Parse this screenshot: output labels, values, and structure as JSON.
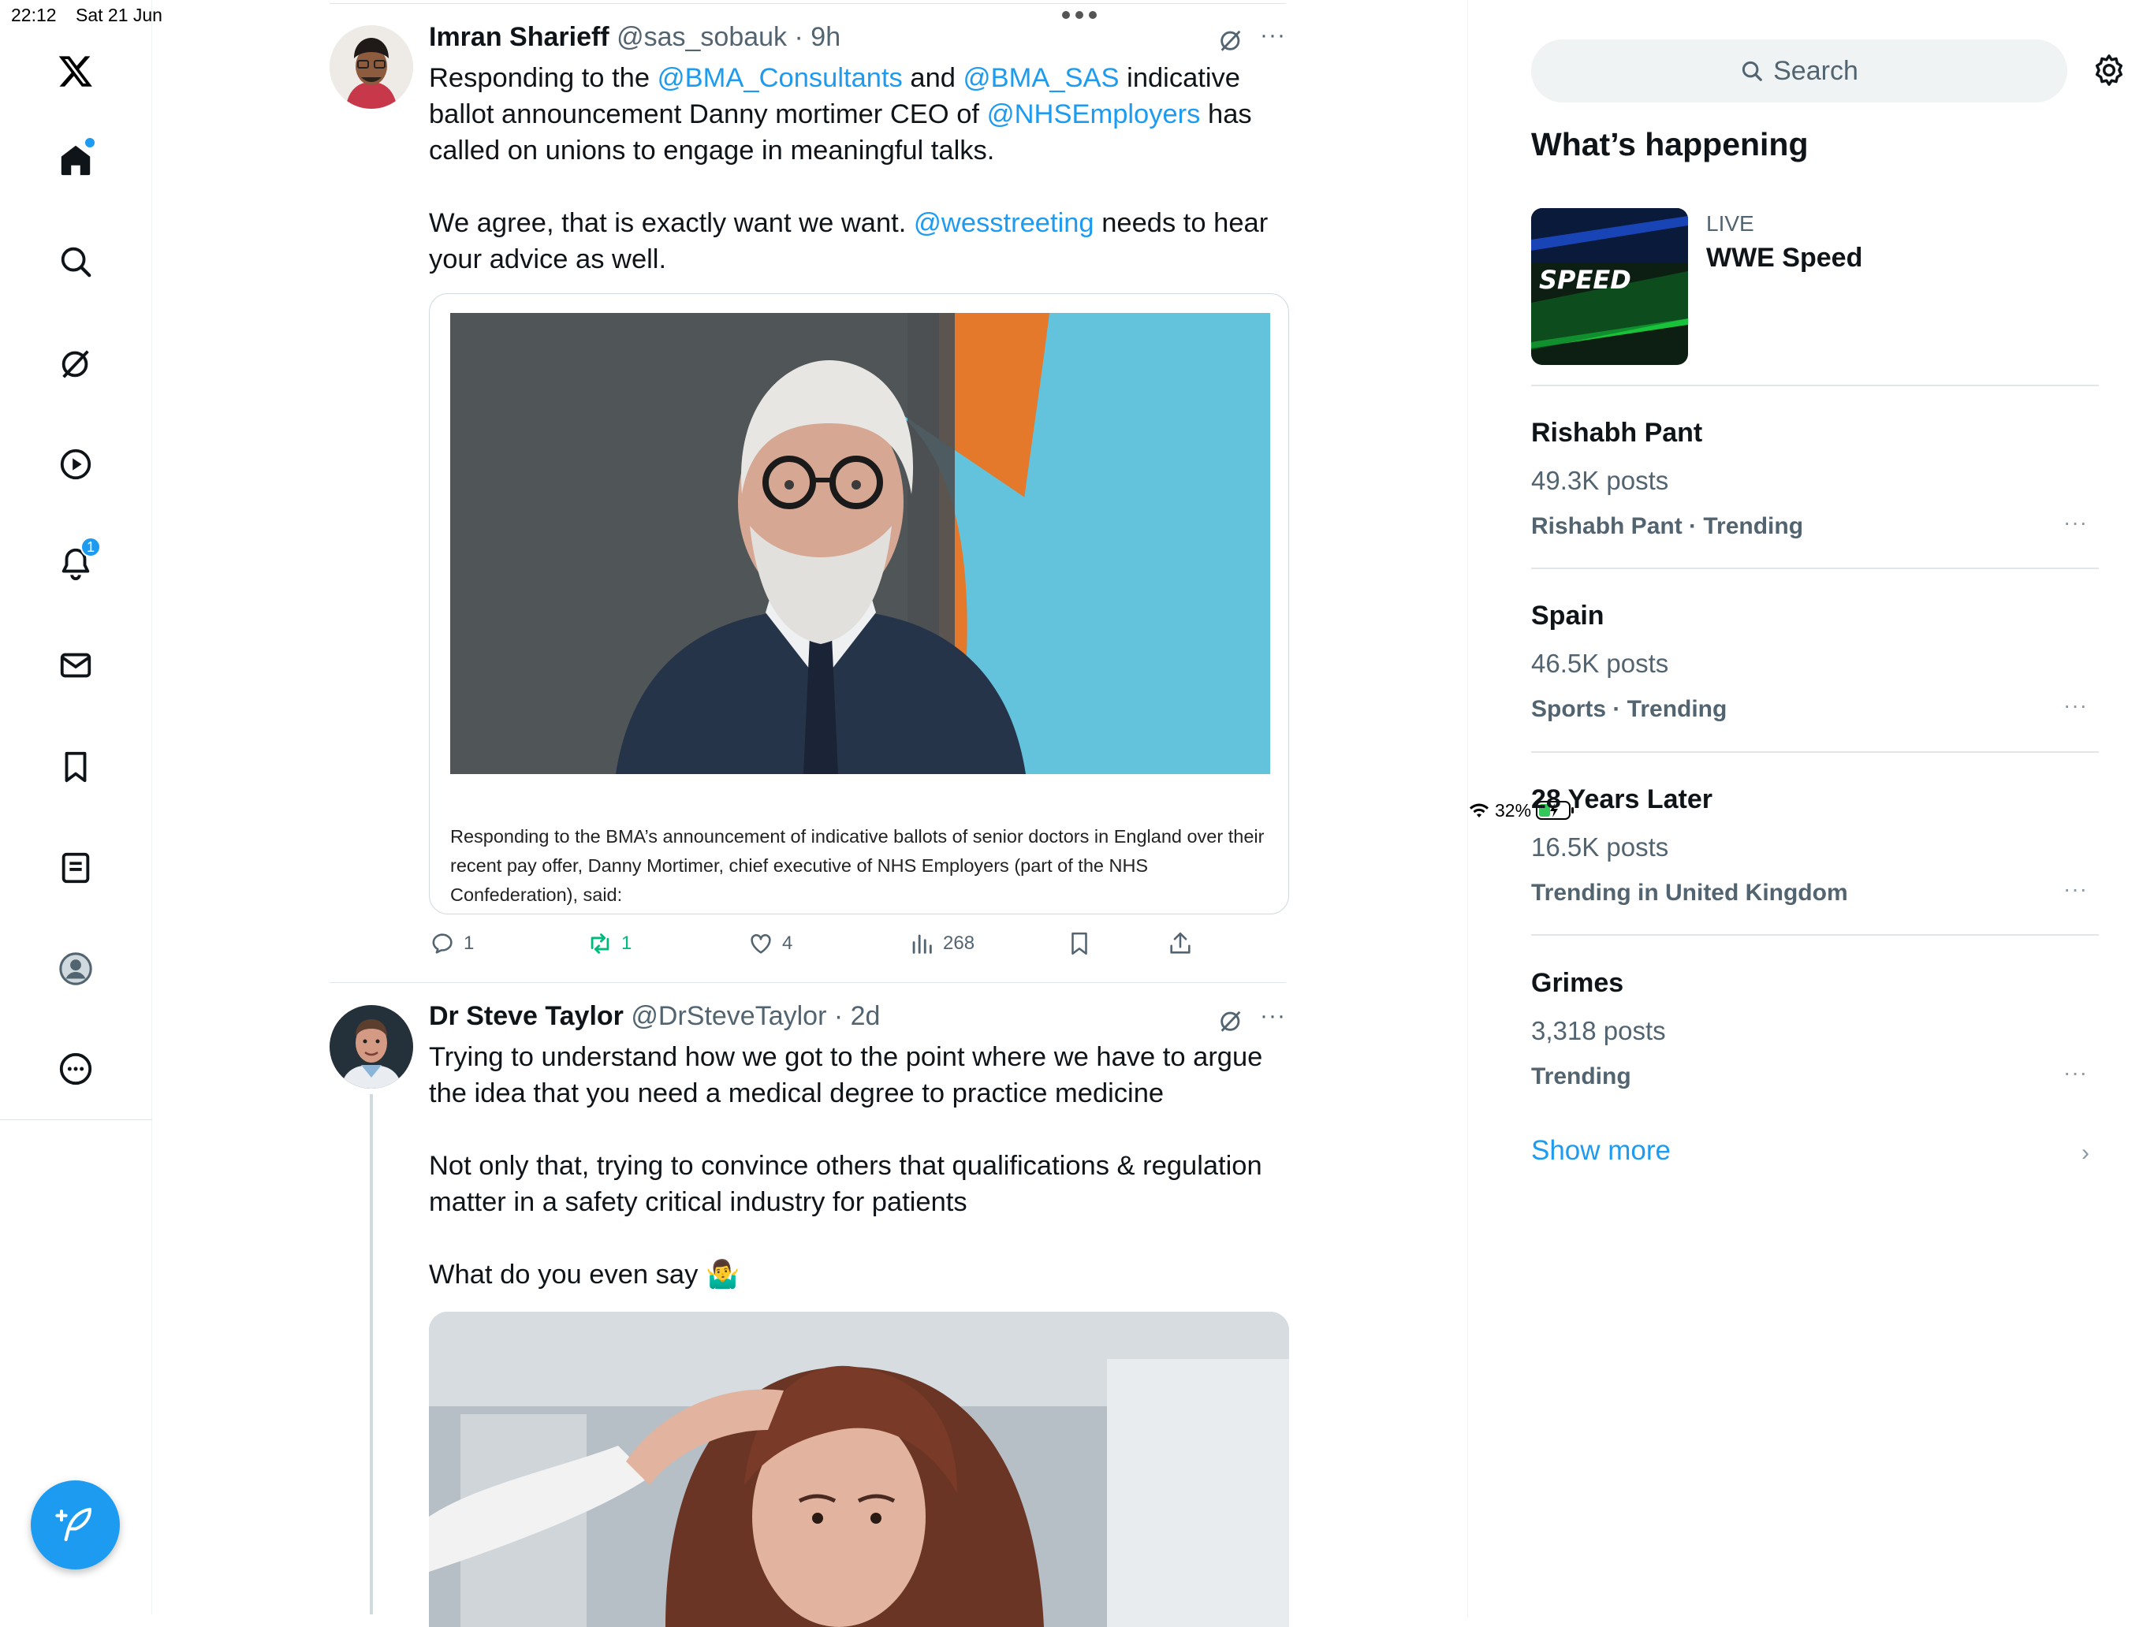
{
  "status_bar": {
    "time": "22:12",
    "date": "Sat 21 Jun",
    "battery": "32%"
  },
  "nav": {
    "notifications_badge": "1"
  },
  "tweet1": {
    "name": "Imran Sharieff",
    "handle": "@sas_sobauk",
    "time": "9h",
    "text1_a": "Responding to the ",
    "mention1": "@BMA_Consultants",
    "text1_b": " and ",
    "mention2": "@BMA_SAS",
    "text1_c": " indicative ballot announcement Danny mortimer CEO of ",
    "mention3": "@NHSEmployers",
    "text1_d": " has called on unions to engage in meaningful talks.",
    "text2_a": "We agree, that is exactly want we want. ",
    "mention4": "@wesstreeting",
    "text2_b": " needs to hear your advice as well.",
    "card_caption": "Responding to the BMA’s announcement of indicative ballots of senior doctors in England over their recent pay offer, Danny Mortimer, chief executive of NHS Employers (part of the NHS Confederation), said:",
    "replies": "1",
    "reposts": "1",
    "likes": "4",
    "views": "268"
  },
  "tweet2": {
    "name": "Dr Steve Taylor",
    "handle": "@DrSteveTaylor",
    "time": "2d",
    "p1": "Trying to understand how we got to the point where we have to argue the idea that you need a medical degree to practice medicine",
    "p2": "Not only that, trying to convince others that qualifications & regulation matter in a safety critical industry for patients",
    "p3": "What do you even say 🤷‍♂️"
  },
  "sidebar": {
    "search_placeholder": "Search",
    "title": "What’s happening",
    "live": {
      "label": "LIVE",
      "title": "WWE Speed",
      "thumb_text": "SPEED"
    },
    "trends": [
      {
        "title": "Rishabh Pant",
        "count": "49.3K posts",
        "meta": "Rishabh Pant · Trending"
      },
      {
        "title": "Spain",
        "count": "46.5K posts",
        "meta": "Sports · Trending"
      },
      {
        "title": "28 Years Later",
        "count": "16.5K posts",
        "meta": "Trending in United Kingdom"
      },
      {
        "title": "Grimes",
        "count": "3,318 posts",
        "meta": "Trending"
      }
    ],
    "show_more": "Show more"
  },
  "colors": {
    "accent": "#1d9bf0",
    "repost": "#00ba7c",
    "muted": "#536471"
  }
}
